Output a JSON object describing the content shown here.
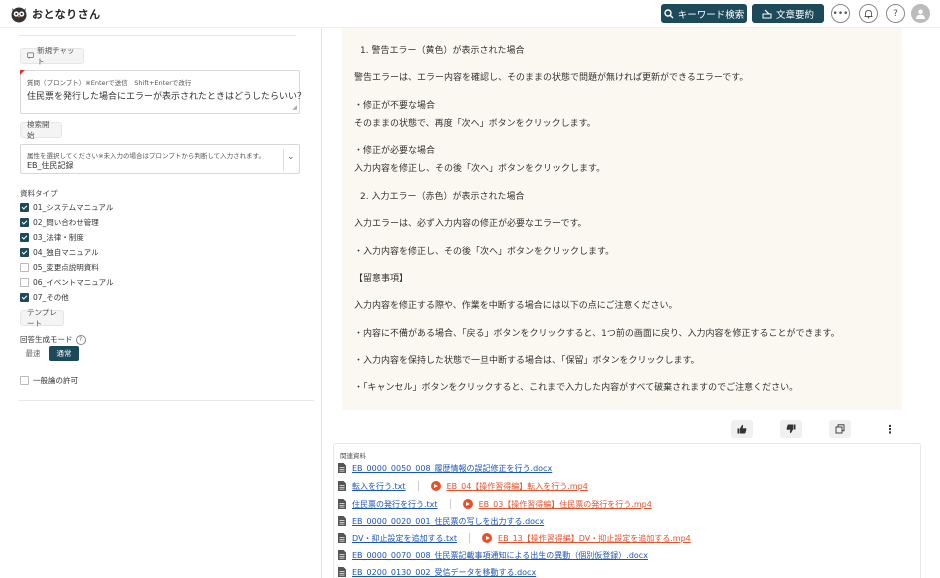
{
  "header": {
    "app_title": "おとなりさん",
    "keyword_search_label": "キーワード検索",
    "summary_label": "文章要約",
    "more_label": "•••",
    "help_label": "?"
  },
  "left": {
    "new_chat_label": "新規チャット",
    "prompt_label": "質問（プロンプト）※Enterで送信　Shift+Enterで改行",
    "prompt_value": "住民票を発行した場合にエラーが表示されたときはどうしたらいい？",
    "search_start_label": "検索開始",
    "attr_label": "属性を選択してください※未入力の場合はプロンプトから判断して入力されます。",
    "attr_value": "EB_住民記録",
    "material_type_label": "資料タイプ",
    "material_types": [
      {
        "label": "01_システムマニュアル",
        "checked": true
      },
      {
        "label": "02_問い合わせ管理",
        "checked": true
      },
      {
        "label": "03_法律・制度",
        "checked": true
      },
      {
        "label": "04_独自マニュアル",
        "checked": true
      },
      {
        "label": "05_変更点説明資料",
        "checked": false
      },
      {
        "label": "06_イベントマニュアル",
        "checked": false
      },
      {
        "label": "07_その他",
        "checked": true
      }
    ],
    "template_label": "テンプレート",
    "mode_label": "回答生成モード",
    "mode_help": "?",
    "mode_fast": "最速",
    "mode_normal": "通常",
    "general_permission_label": "一般論の許可"
  },
  "answer": {
    "lines": [
      "1. 警告エラー（黄色）が表示された場合",
      "警告エラーは、エラー内容を確認し、そのままの状態で問題が無ければ更新ができるエラーです。",
      "・修正が不要な場合",
      "そのままの状態で、再度「次へ」ボタンをクリックします。",
      "・修正が必要な場合",
      "入力内容を修正し、その後「次へ」ボタンをクリックします。",
      "2. 入力エラー（赤色）が表示された場合",
      "入力エラーは、必ず入力内容の修正が必要なエラーです。",
      "・入力内容を修正し、その後「次へ」ボタンをクリックします。",
      "【留意事項】",
      "入力内容を修正する際や、作業を中断する場合には以下の点にご注意ください。",
      "・内容に不備がある場合、「戻る」ボタンをクリックすると、1つ前の画面に戻り、入力内容を修正することができます。",
      "・入力内容を保持した状態で一旦中断する場合は、「保留」ボタンをクリックします。",
      "・「キャンセル」ボタンをクリックすると、これまで入力した内容がすべて破棄されますのでご注意ください。"
    ]
  },
  "references": {
    "title": "関連資料",
    "rows": [
      {
        "doc": "EB_0000_0050_008_履歴情報の誤記修正を行う.docx",
        "video": ""
      },
      {
        "doc": "転入を行う.txt",
        "video": "EB_04【操作習得編】転入を行う.mp4"
      },
      {
        "doc": "住民票の発行を行う.txt",
        "video": "EB_03【操作習得編】住民票の発行を行う.mp4"
      },
      {
        "doc": "EB_0000_0020_001_住民票の写しを出力する.docx",
        "video": ""
      },
      {
        "doc": "DV・抑止設定を追加する.txt",
        "video": "EB_13【操作習得編】DV・抑止設定を追加する.mp4"
      },
      {
        "doc": "EB_0000_0070_008_住民票記載事項通知による出生の異動（個別仮登録）.docx",
        "video": ""
      },
      {
        "doc": "EB_0200_0130_002_受信データを移動する.docx",
        "video": ""
      }
    ]
  },
  "colors": {
    "brand": "#1c4a5a",
    "answer_bg": "#faf8f0",
    "link": "#1a55c0",
    "video": "#e8502a"
  }
}
